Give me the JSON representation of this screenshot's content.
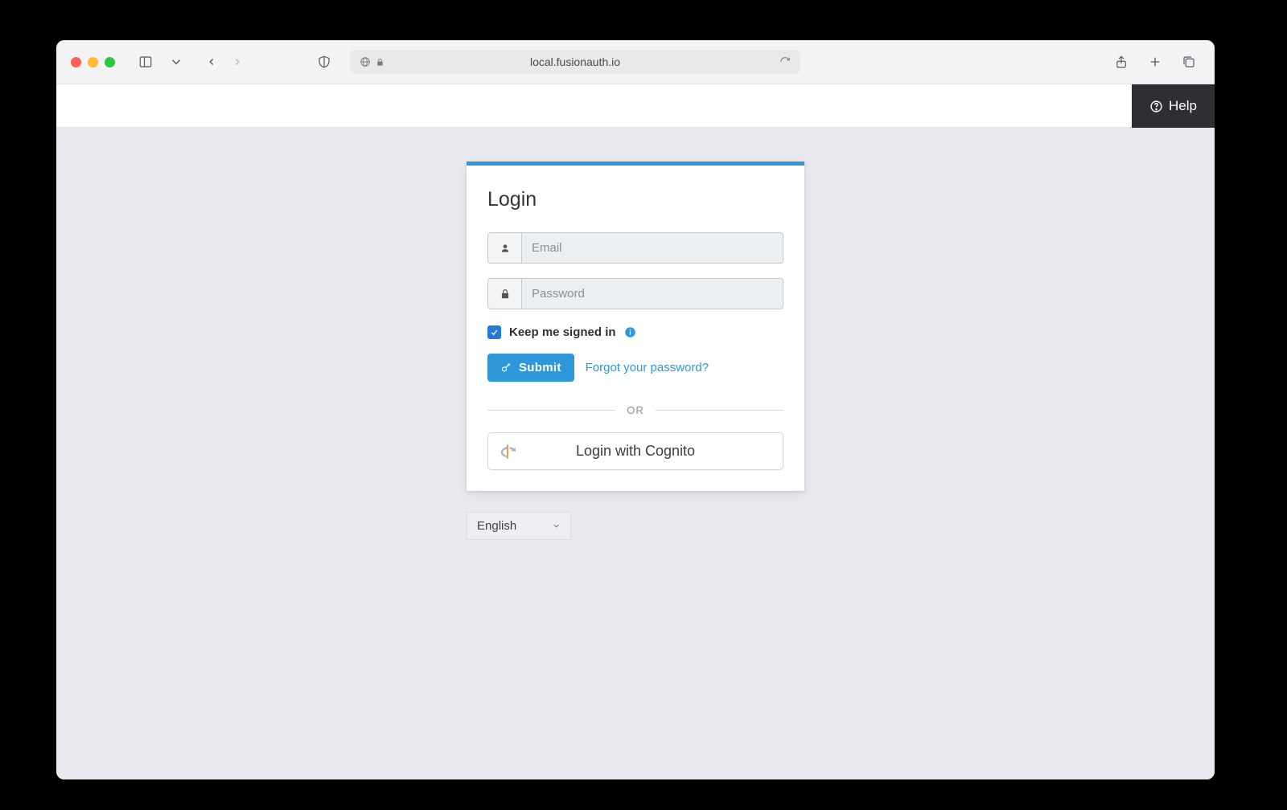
{
  "browser": {
    "url": "local.fusionauth.io"
  },
  "topbar": {
    "help_label": "Help"
  },
  "login": {
    "title": "Login",
    "email_placeholder": "Email",
    "password_placeholder": "Password",
    "keep_signed_in_label": "Keep me signed in",
    "keep_signed_in_checked": true,
    "submit_label": "Submit",
    "forgot_label": "Forgot your password?",
    "divider_label": "OR",
    "idp_button_label": "Login with Cognito"
  },
  "language": {
    "selected": "English"
  }
}
